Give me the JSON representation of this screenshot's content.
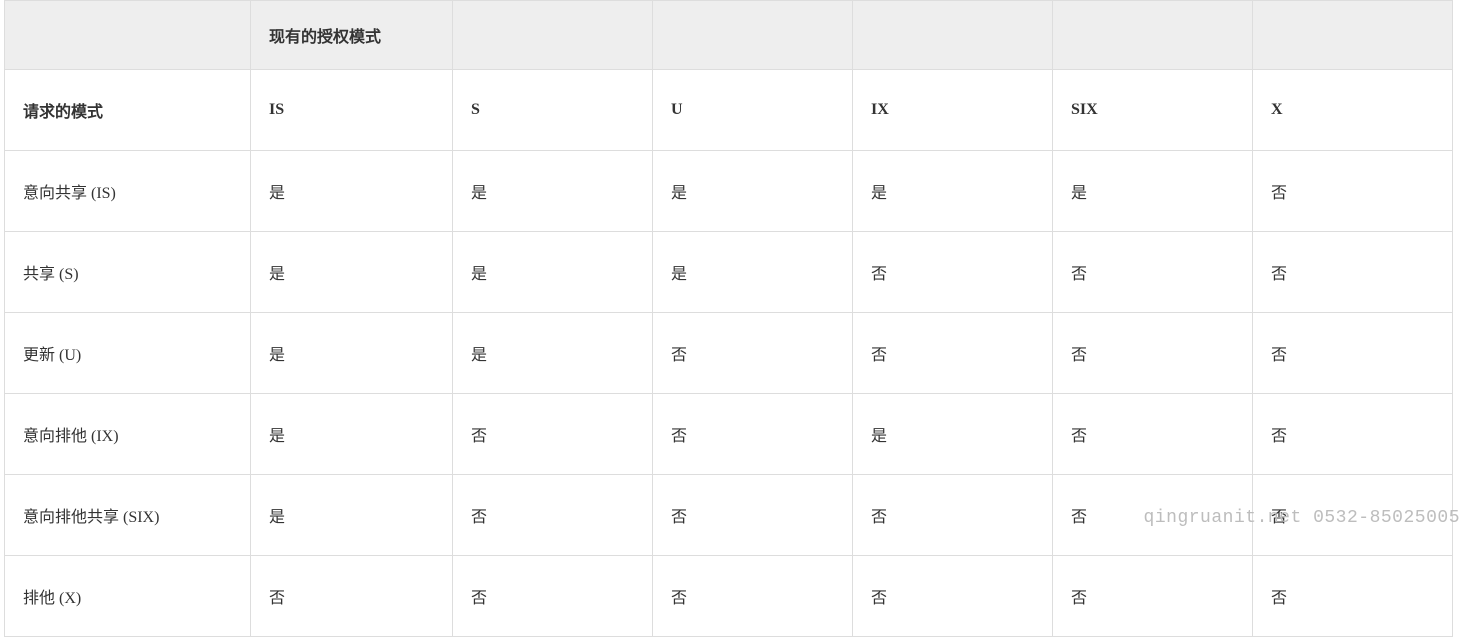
{
  "header": {
    "cells": [
      "",
      "现有的授权模式",
      "",
      "",
      "",
      "",
      ""
    ]
  },
  "rows": [
    {
      "label": "请求的模式",
      "cells": [
        "IS",
        "S",
        "U",
        "IX",
        "SIX",
        "X"
      ],
      "bold": true
    },
    {
      "label": "意向共享 (IS)",
      "cells": [
        "是",
        "是",
        "是",
        "是",
        "是",
        "否"
      ]
    },
    {
      "label": "共享 (S)",
      "cells": [
        "是",
        "是",
        "是",
        "否",
        "否",
        "否"
      ]
    },
    {
      "label": "更新 (U)",
      "cells": [
        "是",
        "是",
        "否",
        "否",
        "否",
        "否"
      ]
    },
    {
      "label": "意向排他 (IX)",
      "cells": [
        "是",
        "否",
        "否",
        "是",
        "否",
        "否"
      ]
    },
    {
      "label": "意向排他共享 (SIX)",
      "cells": [
        "是",
        "否",
        "否",
        "否",
        "否",
        "否"
      ]
    },
    {
      "label": "排他 (X)",
      "cells": [
        "否",
        "否",
        "否",
        "否",
        "否",
        "否"
      ]
    }
  ],
  "watermark": "qingruanit.net 0532-85025005"
}
